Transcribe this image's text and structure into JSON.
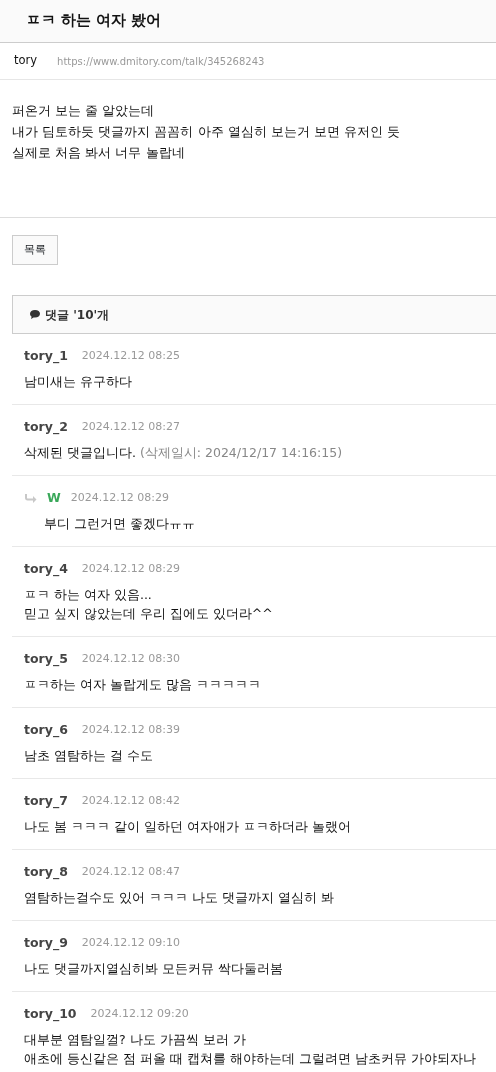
{
  "title": "ㅍㅋ 하는 여자 봤어",
  "meta": {
    "author": "tory",
    "url": "https://www.dmitory.com/talk/345268243"
  },
  "body": [
    "퍼온거 보는 줄 알았는데",
    "내가 딤토하듯 댓글까지 꼼꼼히 아주 열심히 보는거 보면 유저인 듯",
    "실제로 처음 봐서 너무 놀랍네"
  ],
  "list_button": "목록",
  "comments_header": "댓글 '10'개",
  "comments": [
    {
      "kind": "comment",
      "author": "tory_1",
      "time": "2024.12.12 08:25",
      "lines": [
        "남미새는 유구하다"
      ]
    },
    {
      "kind": "comment",
      "author": "tory_2",
      "time": "2024.12.12 08:27",
      "lines": [
        "삭제된 댓글입니다."
      ],
      "note": "(삭제일시: 2024/12/17 14:16:15)"
    },
    {
      "kind": "reply",
      "author": "W",
      "time": "2024.12.12 08:29",
      "lines": [
        "부디 그런거면 좋겠다ㅠㅠ"
      ]
    },
    {
      "kind": "comment",
      "author": "tory_4",
      "time": "2024.12.12 08:29",
      "lines": [
        "ㅍㅋ 하는 여자 있음...",
        "믿고 싶지 않았는데 우리 집에도 있더라^^"
      ]
    },
    {
      "kind": "comment",
      "author": "tory_5",
      "time": "2024.12.12 08:30",
      "lines": [
        "ㅍㅋ하는 여자 놀랍게도 많음 ㅋㅋㅋㅋㅋ"
      ]
    },
    {
      "kind": "comment",
      "author": "tory_6",
      "time": "2024.12.12 08:39",
      "lines": [
        "남초 염탐하는 걸 수도"
      ]
    },
    {
      "kind": "comment",
      "author": "tory_7",
      "time": "2024.12.12 08:42",
      "lines": [
        "나도 봄 ㅋㅋㅋ 같이 일하던 여자애가 ㅍㅋ하더라 놀랬어"
      ]
    },
    {
      "kind": "comment",
      "author": "tory_8",
      "time": "2024.12.12 08:47",
      "lines": [
        "염탐하는걸수도 있어 ㅋㅋㅋ 나도 댓글까지 열심히 봐"
      ]
    },
    {
      "kind": "comment",
      "author": "tory_9",
      "time": "2024.12.12 09:10",
      "lines": [
        "나도 댓글까지열심히봐 모든커뮤 싹다둘러봄"
      ]
    },
    {
      "kind": "comment",
      "author": "tory_10",
      "time": "2024.12.12 09:20",
      "lines": [
        "대부분 염탐일껄? 나도 가끔씩 보러 가",
        "애초에 등신같은 점 퍼올 때 캡쳐를 해야하는데 그럴려면 남초커뮤 가야되자나"
      ]
    }
  ]
}
